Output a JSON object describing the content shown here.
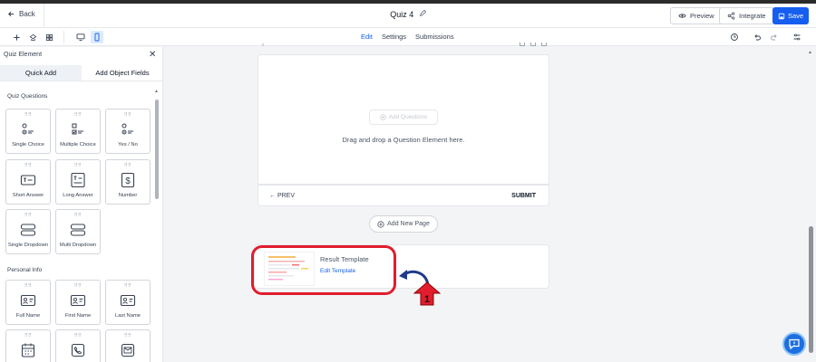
{
  "header": {
    "back_label": "Back",
    "title": "Quiz 4",
    "preview_label": "Preview",
    "integrate_label": "Integrate",
    "save_label": "Save"
  },
  "toolbar": {
    "tabs": [
      {
        "label": "Edit",
        "active": true
      },
      {
        "label": "Settings",
        "active": false
      },
      {
        "label": "Submissions",
        "active": false
      }
    ]
  },
  "sidebar": {
    "heading": "Quiz Element",
    "tabs": [
      {
        "label": "Quick Add",
        "active": true
      },
      {
        "label": "Add Object Fields",
        "active": false
      }
    ],
    "sections": [
      {
        "title": "Quiz Questions",
        "items": [
          {
            "label": "Single Choice",
            "icon": "single-choice-icon"
          },
          {
            "label": "Multiple Choice",
            "icon": "multiple-choice-icon"
          },
          {
            "label": "Yes / No",
            "icon": "yes-no-icon"
          },
          {
            "label": "Short Answer",
            "icon": "short-answer-icon"
          },
          {
            "label": "Long Answer",
            "icon": "long-answer-icon"
          },
          {
            "label": "Number",
            "icon": "dollar-icon"
          },
          {
            "label": "Single Dropdown",
            "icon": "dropdown-icon"
          },
          {
            "label": "Multi Dropdown",
            "icon": "multi-dropdown-icon"
          }
        ]
      },
      {
        "title": "Personal Info",
        "items": [
          {
            "label": "Full Name",
            "icon": "id-card-icon"
          },
          {
            "label": "First Name",
            "icon": "id-card-icon"
          },
          {
            "label": "Last Name",
            "icon": "id-card-icon"
          },
          {
            "label": "",
            "icon": "calendar-icon"
          },
          {
            "label": "",
            "icon": "phone-icon"
          },
          {
            "label": "",
            "icon": "mail-icon"
          }
        ]
      }
    ]
  },
  "canvas": {
    "add_question_label": "Add Questions",
    "drop_hint": "Drag and drop a Question Element here.",
    "prev_label": "← PREV",
    "submit_label": "SUBMIT",
    "add_page_label": "Add New Page",
    "result_template": {
      "title": "Result Template",
      "edit_label": "Edit Template"
    }
  },
  "colors": {
    "primary": "#155eef",
    "highlight": "#e11d2e",
    "annotation_arrow": "#1e3a8a"
  }
}
